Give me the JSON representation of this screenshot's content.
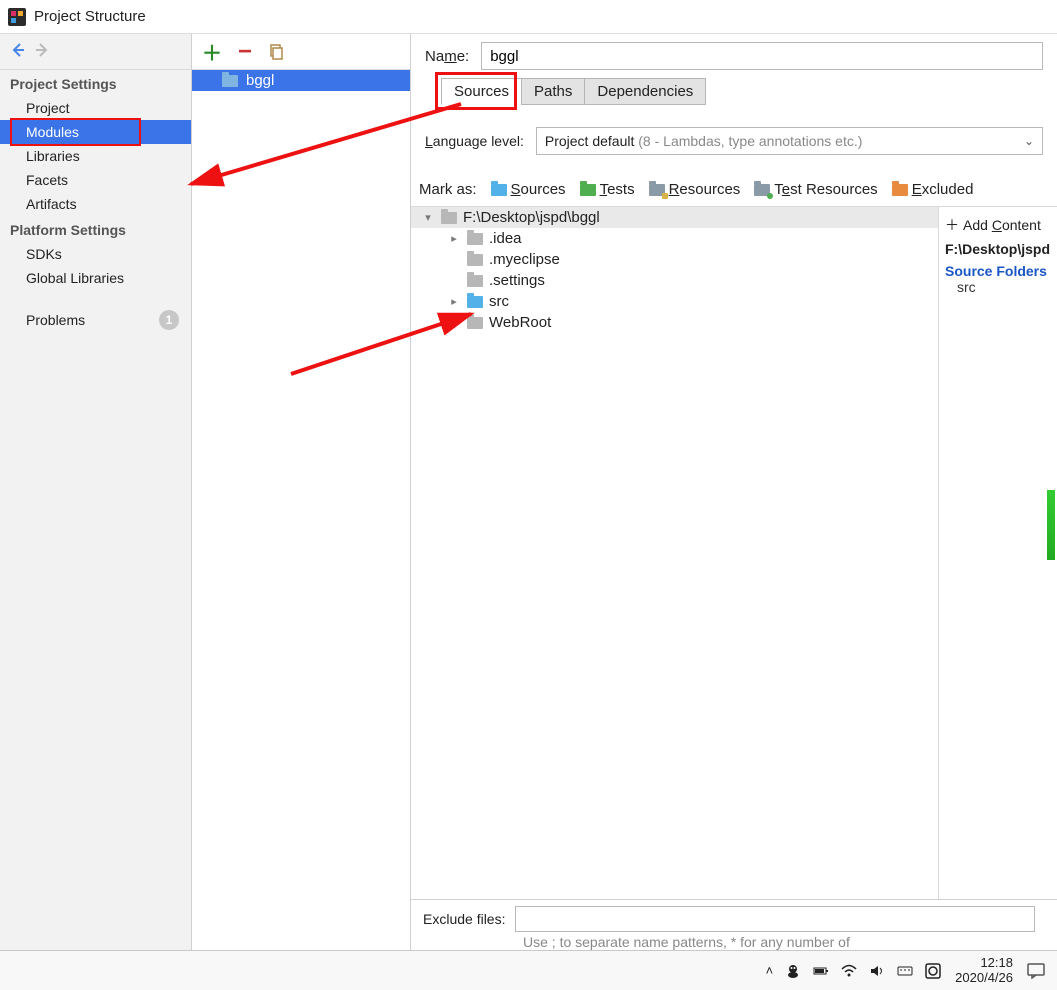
{
  "window": {
    "title": "Project Structure"
  },
  "sidebar": {
    "sections": [
      {
        "header": "Project Settings",
        "items": [
          "Project",
          "Modules",
          "Libraries",
          "Facets",
          "Artifacts"
        ],
        "selectedIndex": 1
      },
      {
        "header": "Platform Settings",
        "items": [
          "SDKs",
          "Global Libraries"
        ]
      }
    ],
    "problems": {
      "label": "Problems",
      "count": "1"
    }
  },
  "modules_list": {
    "items": [
      "bggl"
    ]
  },
  "main": {
    "name_label": "Name:",
    "name_value": "bggl",
    "tabs": [
      "Sources",
      "Paths",
      "Dependencies"
    ],
    "active_tab": 0,
    "language_level_label": "Language level:",
    "language_level_value": "Project default",
    "language_level_hint": "(8 - Lambdas, type annotations etc.)",
    "mark_as_label": "Mark as:",
    "mark_as_buttons": [
      "Sources",
      "Tests",
      "Resources",
      "Test Resources",
      "Excluded"
    ],
    "tree": {
      "root": "F:\\Desktop\\jspd\\bggl",
      "children": [
        {
          "name": ".idea",
          "expandable": true,
          "type": "plain"
        },
        {
          "name": ".myeclipse",
          "expandable": false,
          "type": "plain"
        },
        {
          "name": ".settings",
          "expandable": false,
          "type": "plain"
        },
        {
          "name": "src",
          "expandable": true,
          "type": "src"
        },
        {
          "name": "WebRoot",
          "expandable": true,
          "type": "plain"
        }
      ]
    },
    "right_panel": {
      "add_label": "Add Content",
      "content_root": "F:\\Desktop\\jspd",
      "source_folders_header": "Source Folders",
      "source_folders": [
        "src"
      ]
    },
    "exclude_label": "Exclude files:",
    "exclude_value": "",
    "exclude_hint": "Use ; to separate name patterns, * for any number of"
  },
  "taskbar": {
    "time": "12:18",
    "date": "2020/4/26"
  }
}
